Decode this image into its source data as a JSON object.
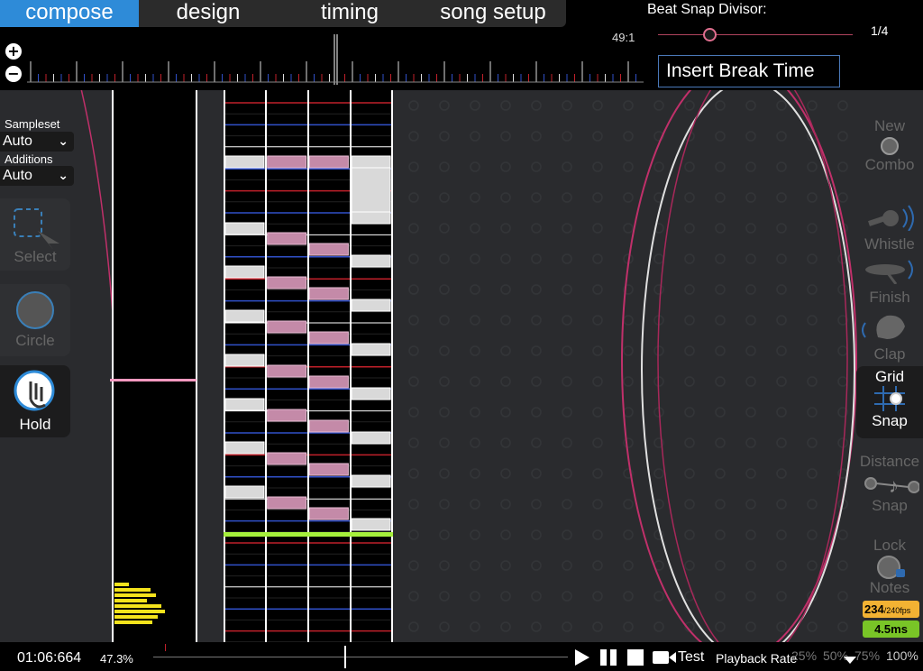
{
  "tabs": [
    {
      "label": "compose",
      "active": true
    },
    {
      "label": "design",
      "active": false
    },
    {
      "label": "timing",
      "active": false
    },
    {
      "label": "song setup",
      "active": false
    }
  ],
  "beat_snap": {
    "title": "Beat Snap Divisor:",
    "value": "1/4",
    "slider_fraction": 0.23
  },
  "top_time": "49:1",
  "insert_break_label": "Insert Break Time",
  "zoom": {
    "in": "+",
    "out": "−"
  },
  "sampleset": {
    "label": "Sampleset",
    "value": "Auto"
  },
  "additions": {
    "label": "Additions",
    "value": "Auto"
  },
  "left_tools": [
    {
      "label": "Select",
      "icon": "select-icon",
      "active": false
    },
    {
      "label": "Circle",
      "icon": "circle-icon",
      "active": false
    },
    {
      "label": "Hold",
      "icon": "hold-icon",
      "active": true
    }
  ],
  "right_tools": {
    "new_combo": [
      "New",
      "Combo"
    ],
    "whistle": "Whistle",
    "finish": "Finish",
    "clap": "Clap",
    "grid_snap": [
      "Grid",
      "Snap"
    ],
    "distance_snap": [
      "Distance",
      "Snap"
    ],
    "lock_notes": [
      "Lock",
      "Notes"
    ]
  },
  "fps": {
    "current": "234",
    "target": "/240fps"
  },
  "frame_time": "4.5ms",
  "bottom": {
    "time": "01:06:664",
    "percent": "47.3%",
    "test_label": "Test",
    "playback_rate_label": "Playback Rate",
    "rates": [
      "25%",
      "50%",
      "75%",
      "100%"
    ],
    "progress_fraction": 0.473
  },
  "colors": {
    "accent_blue": "#2e8bd8",
    "note_white": "#d9d9d9",
    "note_pink": "#c48aa8",
    "beat_red": "#c0202a",
    "beat_blue": "#3050c8",
    "current_line": "#a6f03c",
    "preview_line": "#f59ac0",
    "density_bars": "#f4e31c"
  }
}
